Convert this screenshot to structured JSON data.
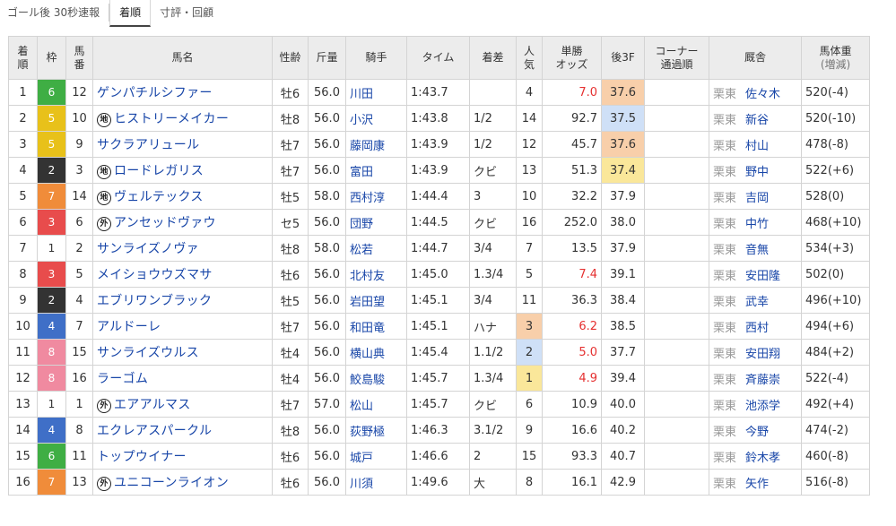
{
  "tabs": [
    "ゴール後 30秒速報",
    "着順",
    "寸評・回顧"
  ],
  "active_tab": 1,
  "headers": {
    "rank": "着\n順",
    "waku": "枠",
    "umaban": "馬\n番",
    "name": "馬名",
    "sex_age": "性齢",
    "weight": "斤量",
    "jockey": "騎手",
    "time": "タイム",
    "margin": "着差",
    "ninki": "人\n気",
    "odds": "単勝\nオッズ",
    "f3": "後3F",
    "corner": "コーナー\n通過順",
    "stable": "厩舎",
    "body_weight": "馬体重",
    "body_weight_sub": "(増減)"
  },
  "waku_colors": {
    "1": {
      "bg": "#ffffff",
      "fg": "#333333"
    },
    "2": {
      "bg": "#333333",
      "fg": "#ffffff"
    },
    "3": {
      "bg": "#e84c4c",
      "fg": "#ffffff"
    },
    "4": {
      "bg": "#3f6fc7",
      "fg": "#ffffff"
    },
    "5": {
      "bg": "#e8c11a",
      "fg": "#ffffff"
    },
    "6": {
      "bg": "#3fae44",
      "fg": "#ffffff"
    },
    "7": {
      "bg": "#f08c3a",
      "fg": "#ffffff"
    },
    "8": {
      "bg": "#f08aa0",
      "fg": "#ffffff"
    }
  },
  "rows": [
    {
      "rank": "1",
      "waku": "6",
      "umaban": "12",
      "badge": "",
      "name": "ゲンパチルシファー",
      "sex_age": "牡6",
      "weight": "56.0",
      "jockey": "川田",
      "time": "1:43.7",
      "margin": "",
      "ninki": "4",
      "odds": "7.0",
      "f3": "37.6",
      "corner": "",
      "area": "栗東",
      "trainer": "佐々木",
      "body_weight": "520(-4)",
      "odds_low": true,
      "f3_rank": 3,
      "ninki_rank": 0
    },
    {
      "rank": "2",
      "waku": "5",
      "umaban": "10",
      "badge": "地",
      "name": "ヒストリーメイカー",
      "sex_age": "牡8",
      "weight": "56.0",
      "jockey": "小沢",
      "time": "1:43.8",
      "margin": "1/2",
      "ninki": "14",
      "odds": "92.7",
      "f3": "37.5",
      "corner": "",
      "area": "栗東",
      "trainer": "新谷",
      "body_weight": "520(-10)",
      "odds_low": false,
      "f3_rank": 2,
      "ninki_rank": 0
    },
    {
      "rank": "3",
      "waku": "5",
      "umaban": "9",
      "badge": "",
      "name": "サクラアリュール",
      "sex_age": "牡7",
      "weight": "56.0",
      "jockey": "藤岡康",
      "time": "1:43.9",
      "margin": "1/2",
      "ninki": "12",
      "odds": "45.7",
      "f3": "37.6",
      "corner": "",
      "area": "栗東",
      "trainer": "村山",
      "body_weight": "478(-8)",
      "odds_low": false,
      "f3_rank": 3,
      "ninki_rank": 0
    },
    {
      "rank": "4",
      "waku": "2",
      "umaban": "3",
      "badge": "地",
      "name": "ロードレガリス",
      "sex_age": "牡7",
      "weight": "56.0",
      "jockey": "富田",
      "time": "1:43.9",
      "margin": "クビ",
      "ninki": "13",
      "odds": "51.3",
      "f3": "37.4",
      "corner": "",
      "area": "栗東",
      "trainer": "野中",
      "body_weight": "522(+6)",
      "odds_low": false,
      "f3_rank": 1,
      "ninki_rank": 0
    },
    {
      "rank": "5",
      "waku": "7",
      "umaban": "14",
      "badge": "地",
      "name": "ヴェルテックス",
      "sex_age": "牡5",
      "weight": "58.0",
      "jockey": "西村淳",
      "time": "1:44.4",
      "margin": "3",
      "ninki": "10",
      "odds": "32.2",
      "f3": "37.9",
      "corner": "",
      "area": "栗東",
      "trainer": "吉岡",
      "body_weight": "528(0)",
      "odds_low": false,
      "f3_rank": 0,
      "ninki_rank": 0
    },
    {
      "rank": "6",
      "waku": "3",
      "umaban": "6",
      "badge": "外",
      "name": "アンセッドヴァウ",
      "sex_age": "セ5",
      "weight": "56.0",
      "jockey": "団野",
      "time": "1:44.5",
      "margin": "クビ",
      "ninki": "16",
      "odds": "252.0",
      "f3": "38.0",
      "corner": "",
      "area": "栗東",
      "trainer": "中竹",
      "body_weight": "468(+10)",
      "odds_low": false,
      "f3_rank": 0,
      "ninki_rank": 0
    },
    {
      "rank": "7",
      "waku": "1",
      "umaban": "2",
      "badge": "",
      "name": "サンライズノヴァ",
      "sex_age": "牡8",
      "weight": "58.0",
      "jockey": "松若",
      "time": "1:44.7",
      "margin": "3/4",
      "ninki": "7",
      "odds": "13.5",
      "f3": "37.9",
      "corner": "",
      "area": "栗東",
      "trainer": "音無",
      "body_weight": "534(+3)",
      "odds_low": false,
      "f3_rank": 0,
      "ninki_rank": 0
    },
    {
      "rank": "8",
      "waku": "3",
      "umaban": "5",
      "badge": "",
      "name": "メイショウウズマサ",
      "sex_age": "牡6",
      "weight": "56.0",
      "jockey": "北村友",
      "time": "1:45.0",
      "margin": "1.3/4",
      "ninki": "5",
      "odds": "7.4",
      "f3": "39.1",
      "corner": "",
      "area": "栗東",
      "trainer": "安田隆",
      "body_weight": "502(0)",
      "odds_low": true,
      "f3_rank": 0,
      "ninki_rank": 0
    },
    {
      "rank": "9",
      "waku": "2",
      "umaban": "4",
      "badge": "",
      "name": "エブリワンブラック",
      "sex_age": "牡5",
      "weight": "56.0",
      "jockey": "岩田望",
      "time": "1:45.1",
      "margin": "3/4",
      "ninki": "11",
      "odds": "36.3",
      "f3": "38.4",
      "corner": "",
      "area": "栗東",
      "trainer": "武幸",
      "body_weight": "496(+10)",
      "odds_low": false,
      "f3_rank": 0,
      "ninki_rank": 0
    },
    {
      "rank": "10",
      "waku": "4",
      "umaban": "7",
      "badge": "",
      "name": "アルドーレ",
      "sex_age": "牡7",
      "weight": "56.0",
      "jockey": "和田竜",
      "time": "1:45.1",
      "margin": "ハナ",
      "ninki": "3",
      "odds": "6.2",
      "f3": "38.5",
      "corner": "",
      "area": "栗東",
      "trainer": "西村",
      "body_weight": "494(+6)",
      "odds_low": true,
      "f3_rank": 0,
      "ninki_rank": 3
    },
    {
      "rank": "11",
      "waku": "8",
      "umaban": "15",
      "badge": "",
      "name": "サンライズウルス",
      "sex_age": "牡4",
      "weight": "56.0",
      "jockey": "横山典",
      "time": "1:45.4",
      "margin": "1.1/2",
      "ninki": "2",
      "odds": "5.0",
      "f3": "37.7",
      "corner": "",
      "area": "栗東",
      "trainer": "安田翔",
      "body_weight": "484(+2)",
      "odds_low": true,
      "f3_rank": 0,
      "ninki_rank": 2
    },
    {
      "rank": "12",
      "waku": "8",
      "umaban": "16",
      "badge": "",
      "name": "ラーゴム",
      "sex_age": "牡4",
      "weight": "56.0",
      "jockey": "鮫島駿",
      "time": "1:45.7",
      "margin": "1.3/4",
      "ninki": "1",
      "odds": "4.9",
      "f3": "39.4",
      "corner": "",
      "area": "栗東",
      "trainer": "斉藤崇",
      "body_weight": "522(-4)",
      "odds_low": true,
      "f3_rank": 0,
      "ninki_rank": 1
    },
    {
      "rank": "13",
      "waku": "1",
      "umaban": "1",
      "badge": "外",
      "name": "エアアルマス",
      "sex_age": "牡7",
      "weight": "57.0",
      "jockey": "松山",
      "time": "1:45.7",
      "margin": "クビ",
      "ninki": "6",
      "odds": "10.9",
      "f3": "40.0",
      "corner": "",
      "area": "栗東",
      "trainer": "池添学",
      "body_weight": "492(+4)",
      "odds_low": false,
      "f3_rank": 0,
      "ninki_rank": 0
    },
    {
      "rank": "14",
      "waku": "4",
      "umaban": "8",
      "badge": "",
      "name": "エクレアスパークル",
      "sex_age": "牡8",
      "weight": "56.0",
      "jockey": "荻野極",
      "time": "1:46.3",
      "margin": "3.1/2",
      "ninki": "9",
      "odds": "16.6",
      "f3": "40.2",
      "corner": "",
      "area": "栗東",
      "trainer": "今野",
      "body_weight": "474(-2)",
      "odds_low": false,
      "f3_rank": 0,
      "ninki_rank": 0
    },
    {
      "rank": "15",
      "waku": "6",
      "umaban": "11",
      "badge": "",
      "name": "トップウイナー",
      "sex_age": "牡6",
      "weight": "56.0",
      "jockey": "城戸",
      "time": "1:46.6",
      "margin": "2",
      "ninki": "15",
      "odds": "93.3",
      "f3": "40.7",
      "corner": "",
      "area": "栗東",
      "trainer": "鈴木孝",
      "body_weight": "460(-8)",
      "odds_low": false,
      "f3_rank": 0,
      "ninki_rank": 0
    },
    {
      "rank": "16",
      "waku": "7",
      "umaban": "13",
      "badge": "外",
      "name": "ユニコーンライオン",
      "sex_age": "牡6",
      "weight": "56.0",
      "jockey": "川須",
      "time": "1:49.6",
      "margin": "大",
      "ninki": "8",
      "odds": "16.1",
      "f3": "42.9",
      "corner": "",
      "area": "栗東",
      "trainer": "矢作",
      "body_weight": "516(-8)",
      "odds_low": false,
      "f3_rank": 0,
      "ninki_rank": 0
    }
  ]
}
